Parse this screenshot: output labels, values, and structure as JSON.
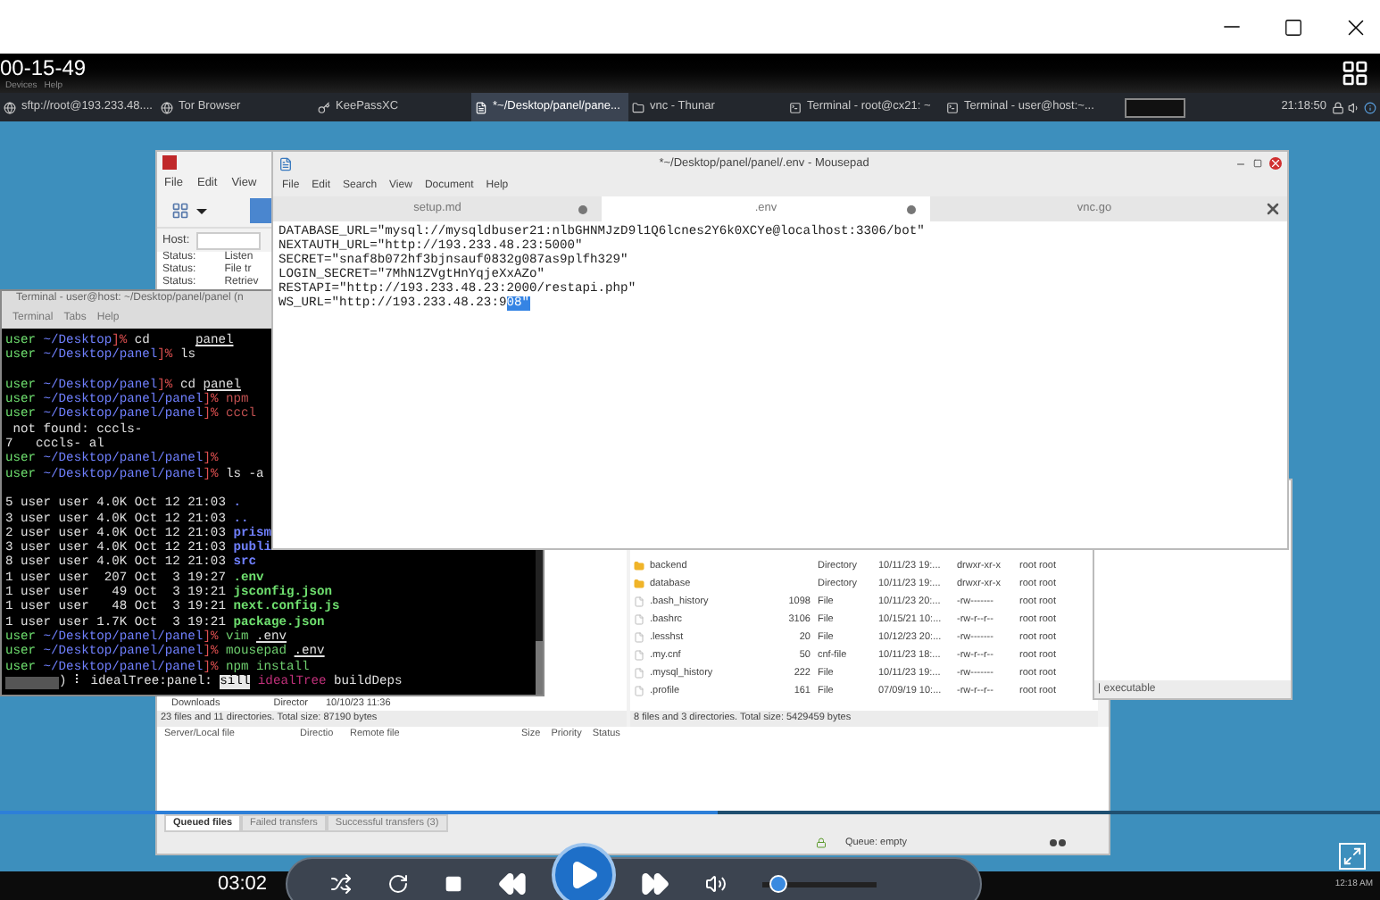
{
  "player": {
    "overlay_time": "00-15-49",
    "elapsed": "03:02",
    "progress": {
      "level": 0.52
    },
    "volume": {
      "level": 0.08
    }
  },
  "vm_menu": [
    "Devices",
    "Help"
  ],
  "taskbar": {
    "items": [
      {
        "label": "sftp://root@193.233.48....",
        "kind": "web",
        "selected": false
      },
      {
        "label": "Tor Browser",
        "kind": "web",
        "selected": false
      },
      {
        "label": "KeePassXC",
        "kind": "key",
        "selected": false
      },
      {
        "label": "*~/Desktop/panel/pane...",
        "kind": "editor",
        "selected": true
      },
      {
        "label": "vnc - Thunar",
        "kind": "folder",
        "selected": false
      },
      {
        "label": "Terminal - root@cx21: ~",
        "kind": "terminal",
        "selected": false
      },
      {
        "label": "Terminal - user@host:~...",
        "kind": "terminal",
        "selected": false
      }
    ],
    "clock": "21:18:50"
  },
  "filezilla": {
    "menu": [
      "File",
      "Edit",
      "View"
    ],
    "host_label": "Host:",
    "status_lines": [
      {
        "label": "Status:",
        "text": "Listen"
      },
      {
        "label": "Status:",
        "text": "File tr"
      },
      {
        "label": "Status:",
        "text": "Retriev"
      }
    ],
    "local_rows": [
      {
        "name": "Downloads",
        "type": "Director",
        "modified": "10/10/23 11:36"
      }
    ],
    "local_summary": "23 files and 11 directories. Total size: 87190 bytes",
    "remote_rows": [
      {
        "name": "backend",
        "kind": "folder",
        "size": "",
        "type": "Directory",
        "modified": "10/11/23 19:...",
        "permissions": "drwxr-xr-x",
        "owner": "root root"
      },
      {
        "name": "database",
        "kind": "folder",
        "size": "",
        "type": "Directory",
        "modified": "10/11/23 19:...",
        "permissions": "drwxr-xr-x",
        "owner": "root root"
      },
      {
        "name": ".bash_history",
        "kind": "file",
        "size": "1098",
        "type": "File",
        "modified": "10/11/23 20:...",
        "permissions": "-rw-------",
        "owner": "root root"
      },
      {
        "name": ".bashrc",
        "kind": "file",
        "size": "3106",
        "type": "File",
        "modified": "10/15/21 10:...",
        "permissions": "-rw-r--r--",
        "owner": "root root"
      },
      {
        "name": ".lesshst",
        "kind": "file",
        "size": "20",
        "type": "File",
        "modified": "10/12/23 20:...",
        "permissions": "-rw-------",
        "owner": "root root"
      },
      {
        "name": ".my.cnf",
        "kind": "file",
        "size": "50",
        "type": "cnf-file",
        "modified": "10/11/23 18:...",
        "permissions": "-rw-r--r--",
        "owner": "root root"
      },
      {
        "name": ".mysql_history",
        "kind": "file",
        "size": "222",
        "type": "File",
        "modified": "10/11/23 19:...",
        "permissions": "-rw-------",
        "owner": "root root"
      },
      {
        "name": ".profile",
        "kind": "file",
        "size": "161",
        "type": "File",
        "modified": "07/09/19 10:...",
        "permissions": "-rw-r--r--",
        "owner": "root root"
      }
    ],
    "remote_summary": "8 files and 3 directories. Total size: 5429459 bytes",
    "queue_columns": [
      "Server/Local file",
      "Directio",
      "Remote file",
      "Size",
      "Priority",
      "Status"
    ],
    "queue_tabs": [
      {
        "label": "Queued files",
        "selected": true
      },
      {
        "label": "Failed transfers",
        "selected": false
      },
      {
        "label": "Successful transfers (3)",
        "selected": false
      }
    ],
    "queue_status": "Queue: empty"
  },
  "mousepad": {
    "title": "*~/Desktop/panel/panel/.env - Mousepad",
    "menu": [
      "File",
      "Edit",
      "Search",
      "View",
      "Document",
      "Help"
    ],
    "tabs": [
      {
        "label": "setup.md",
        "modified": true,
        "selected": false
      },
      {
        "label": ".env",
        "modified": true,
        "selected": true
      },
      {
        "label": "vnc.go",
        "modified": false,
        "selected": false
      }
    ],
    "lines": [
      [
        {
          "text": "DATABASE_URL=\"mysql://mysqldbuser21:nlbGHNMJzD9l1Q6lcnes2Y6k0XCYe@localhost:3306/bot\"",
          "selected": false
        }
      ],
      [
        {
          "text": "NEXTAUTH_URL=\"http://193.233.48.23:5000\"",
          "selected": false
        }
      ],
      [
        {
          "text": "SECRET=\"snaf8b072hf3bjnsauf0832g087as9plfh329\"",
          "selected": false
        }
      ],
      [
        {
          "text": "LOGIN_SECRET=\"7MhN1ZVgtHnYqjeXxAZo\"",
          "selected": false
        }
      ],
      [
        {
          "text": "RESTAPI=\"http://193.233.48.23:2000/restapi.php\"",
          "selected": false
        }
      ],
      [
        {
          "text": "WS_URL=\"http://193.233.48.23:9",
          "selected": false
        },
        {
          "text": "08\"",
          "selected": true
        }
      ]
    ]
  },
  "file_manager": {
    "status": "| executable"
  },
  "terminal": {
    "title": "Terminal - user@host: ~/Desktop/panel/panel (n",
    "menu": [
      "Terminal",
      "Tabs",
      "Help"
    ],
    "lines": [
      {
        "segments": [
          {
            "kind": "user",
            "text": "user"
          },
          {
            "kind": "path",
            "text": " ~/Desktop"
          },
          {
            "kind": "sym",
            "text": "]% "
          },
          {
            "kind": "cmd",
            "text": "cd      "
          },
          {
            "kind": "link",
            "text": "panel"
          }
        ]
      },
      {
        "segments": [
          {
            "kind": "user",
            "text": "user"
          },
          {
            "kind": "path",
            "text": " ~/Desktop/panel"
          },
          {
            "kind": "sym",
            "text": "]% "
          },
          {
            "kind": "cmd",
            "text": "ls"
          }
        ]
      },
      {
        "gap": true,
        "segments": [
          {
            "kind": "user",
            "text": "user"
          },
          {
            "kind": "path",
            "text": " ~/Desktop/panel"
          },
          {
            "kind": "sym",
            "text": "]% "
          },
          {
            "kind": "cmd",
            "text": "cd "
          },
          {
            "kind": "link",
            "text": "panel"
          }
        ]
      },
      {
        "segments": [
          {
            "kind": "user",
            "text": "user"
          },
          {
            "kind": "path",
            "text": " ~/Desktop/panel/panel"
          },
          {
            "kind": "sym",
            "text": "]% "
          },
          {
            "kind": "bad",
            "text": "npm"
          }
        ]
      },
      {
        "segments": [
          {
            "kind": "user",
            "text": "user"
          },
          {
            "kind": "path",
            "text": " ~/Desktop/panel/panel"
          },
          {
            "kind": "sym",
            "text": "]% "
          },
          {
            "kind": "bad",
            "text": "cccl"
          }
        ]
      },
      {
        "segments": [
          {
            "kind": "text",
            "text": " not found: cccls-"
          }
        ]
      },
      {
        "segments": [
          {
            "kind": "text",
            "text": "7   cccls- al"
          }
        ]
      },
      {
        "segments": [
          {
            "kind": "user",
            "text": "user"
          },
          {
            "kind": "path",
            "text": " ~/Desktop/panel/panel"
          },
          {
            "kind": "sym",
            "text": "]%"
          }
        ]
      },
      {
        "segments": [
          {
            "kind": "user",
            "text": "user"
          },
          {
            "kind": "path",
            "text": " ~/Desktop/panel/panel"
          },
          {
            "kind": "sym",
            "text": "]% "
          },
          {
            "kind": "cmd",
            "text": "ls -a"
          }
        ]
      },
      {
        "gap": true,
        "segments": [
          {
            "kind": "text",
            "text": "5 user user 4.0K Oct 12 21:03 "
          },
          {
            "kind": "dir",
            "text": "."
          }
        ]
      },
      {
        "segments": [
          {
            "kind": "text",
            "text": "3 user user 4.0K Oct 12 21:03 "
          },
          {
            "kind": "dir",
            "text": ".."
          }
        ]
      },
      {
        "segments": [
          {
            "kind": "text",
            "text": "2 user user 4.0K Oct 12 21:03 "
          },
          {
            "kind": "dir",
            "text": "prism"
          }
        ]
      },
      {
        "segments": [
          {
            "kind": "text",
            "text": "3 user user 4.0K Oct 12 21:03 "
          },
          {
            "kind": "dir",
            "text": "publi"
          }
        ]
      },
      {
        "segments": [
          {
            "kind": "text",
            "text": "8 user user 4.0K Oct 12 21:03 "
          },
          {
            "kind": "dir",
            "text": "src"
          }
        ]
      },
      {
        "segments": [
          {
            "kind": "text",
            "text": "1 user user  207 Oct  3 19:27 "
          },
          {
            "kind": "exec",
            "text": ".env"
          }
        ]
      },
      {
        "segments": [
          {
            "kind": "text",
            "text": "1 user user   49 Oct  3 19:21 "
          },
          {
            "kind": "exec",
            "text": "jsconfig.json"
          }
        ]
      },
      {
        "segments": [
          {
            "kind": "text",
            "text": "1 user user   48 Oct  3 19:21 "
          },
          {
            "kind": "exec",
            "text": "next.config.js"
          }
        ]
      },
      {
        "segments": [
          {
            "kind": "text",
            "text": "1 user user 1.7K Oct  3 19:21 "
          },
          {
            "kind": "exec",
            "text": "package.json"
          }
        ]
      },
      {
        "segments": [
          {
            "kind": "user",
            "text": "user"
          },
          {
            "kind": "path",
            "text": " ~/Desktop/panel/panel"
          },
          {
            "kind": "sym",
            "text": "]% "
          },
          {
            "kind": "good",
            "text": "vim "
          },
          {
            "kind": "link",
            "text": ".env"
          }
        ]
      },
      {
        "segments": [
          {
            "kind": "user",
            "text": "user"
          },
          {
            "kind": "path",
            "text": " ~/Desktop/panel/panel"
          },
          {
            "kind": "sym",
            "text": "]% "
          },
          {
            "kind": "good",
            "text": "mousepad "
          },
          {
            "kind": "link",
            "text": ".env"
          }
        ]
      },
      {
        "segments": [
          {
            "kind": "user",
            "text": "user"
          },
          {
            "kind": "path",
            "text": " ~/Desktop/panel/panel"
          },
          {
            "kind": "sym",
            "text": "]% "
          },
          {
            "kind": "good",
            "text": "npm install"
          }
        ]
      },
      {
        "progress_bar": true,
        "segments": [
          {
            "kind": "text",
            "text": ") ⠇ idealTree:panel: "
          },
          {
            "kind": "inv",
            "text": "sill"
          },
          {
            "kind": "pink",
            "text": " idealTree"
          },
          {
            "kind": "text",
            "text": " buildDeps"
          }
        ]
      }
    ]
  },
  "host_clock": "12:18 AM"
}
